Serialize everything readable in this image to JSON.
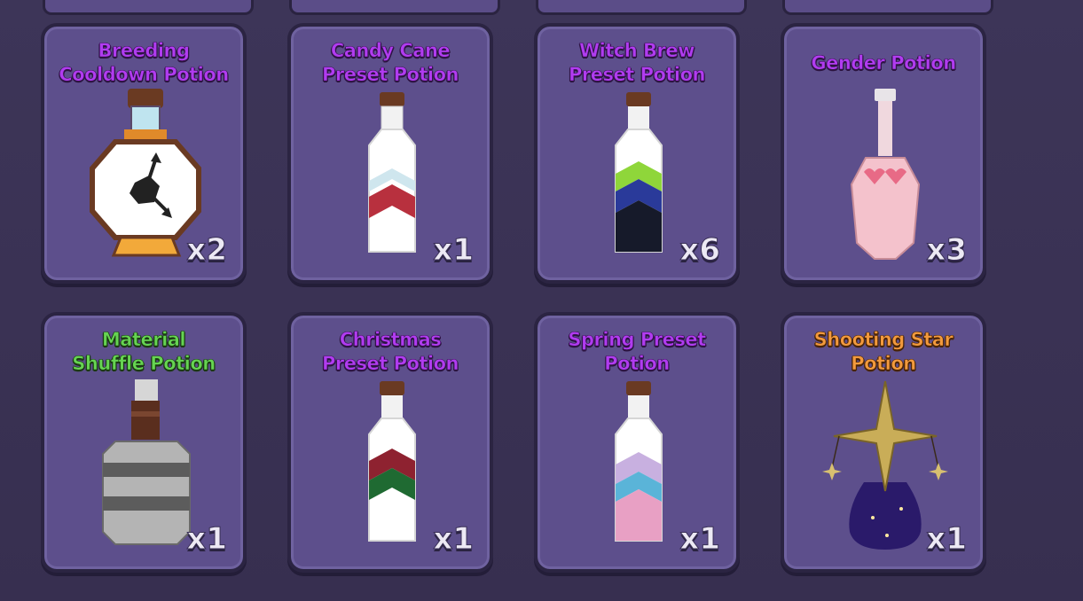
{
  "items": [
    {
      "name": "Breeding\nCooldown Potion",
      "qty": "x2",
      "icon": "clock-potion-icon"
    },
    {
      "name": "Candy Cane\nPreset Potion",
      "qty": "x1",
      "icon": "candy-cane-bottle-icon"
    },
    {
      "name": "Witch Brew\nPreset Potion",
      "qty": "x6",
      "icon": "witch-brew-bottle-icon"
    },
    {
      "name": "Gender Potion",
      "qty": "x3",
      "icon": "heart-flask-icon"
    },
    {
      "name": "Material\nShuffle Potion",
      "qty": "x1",
      "icon": "stone-jug-icon"
    },
    {
      "name": "Christmas\nPreset Potion",
      "qty": "x1",
      "icon": "christmas-bottle-icon"
    },
    {
      "name": "Spring Preset\nPotion",
      "qty": "x1",
      "icon": "spring-bottle-icon"
    },
    {
      "name": "Shooting Star\nPotion",
      "qty": "x1",
      "icon": "star-flask-icon"
    }
  ],
  "colors": {
    "card_bg": "#5d4f8c",
    "name_purple": "#b13cf0",
    "name_green": "#66d452",
    "name_orange": "#f39a3d"
  }
}
